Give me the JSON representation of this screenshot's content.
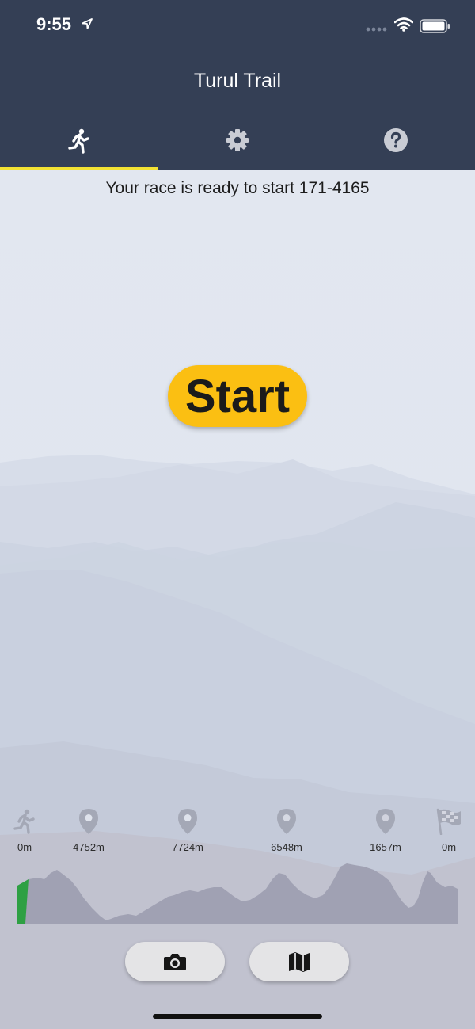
{
  "status_bar": {
    "time": "9:55"
  },
  "header": {
    "title": "Turul Trail",
    "tabs": [
      {
        "icon": "runner-icon",
        "active": true
      },
      {
        "icon": "gear-icon",
        "active": false
      },
      {
        "icon": "help-icon",
        "active": false
      }
    ],
    "accent": "#f3e233",
    "background": "#343f55"
  },
  "main": {
    "status_text": "Your race is ready to start 171-4165",
    "start_label": "Start",
    "start_color": "#fbbf12"
  },
  "route": {
    "markers": [
      {
        "icon": "runner-icon",
        "label": "0m"
      },
      {
        "icon": "pin-icon",
        "label": "4752m"
      },
      {
        "icon": "pin-icon",
        "label": "7724m"
      },
      {
        "icon": "pin-icon",
        "label": "6548m"
      },
      {
        "icon": "pin-icon",
        "label": "1657m"
      },
      {
        "icon": "checkered-flag-icon",
        "label": "0m"
      }
    ],
    "progress_color": "#2ea043"
  },
  "actions": [
    {
      "icon": "camera-icon"
    },
    {
      "icon": "map-icon"
    }
  ]
}
